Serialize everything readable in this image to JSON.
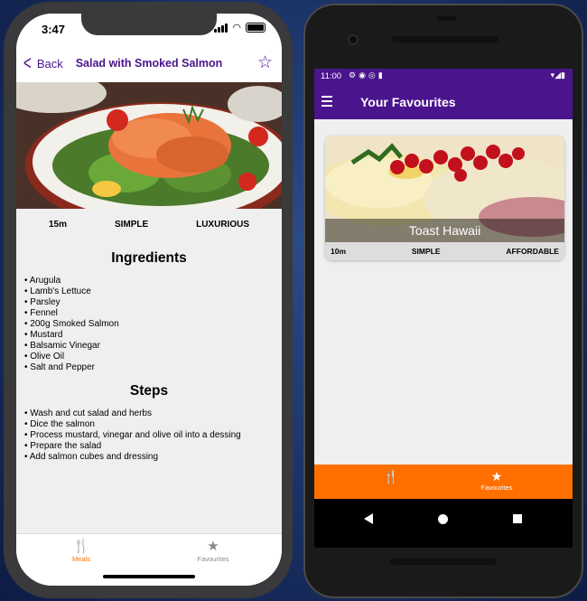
{
  "ios": {
    "status_time": "3:47",
    "nav": {
      "back_label": "Back",
      "title": "Salad with Smoked Salmon",
      "favorite_icon": "star-outline-icon"
    },
    "meal_info": {
      "duration": "15m",
      "complexity": "SIMPLE",
      "affordability": "LUXURIOUS"
    },
    "ingredients_title": "Ingredients",
    "ingredients": [
      "Arugula",
      "Lamb's Lettuce",
      "Parsley",
      "Fennel",
      "200g Smoked Salmon",
      "Mustard",
      "Balsamic Vinegar",
      "Olive Oil",
      "Salt and Pepper"
    ],
    "steps_title": "Steps",
    "steps": [
      "Wash and cut salad and herbs",
      "Dice the salmon",
      "Process mustard, vinegar and olive oil into a dessing",
      "Prepare the salad",
      "Add salmon cubes and dressing"
    ],
    "tabs": [
      {
        "label": "Meals",
        "icon": "cutlery-icon",
        "color": "#ff6f00"
      },
      {
        "label": "Favourites",
        "icon": "star-icon",
        "color": "#888888"
      }
    ]
  },
  "android": {
    "status_time": "11:00",
    "appbar_title": "Your Favourites",
    "favourites": [
      {
        "title": "Toast Hawaii",
        "duration": "10m",
        "complexity": "SIMPLE",
        "affordability": "AFFORDABLE"
      }
    ],
    "tabs": [
      {
        "label": "",
        "icon": "cutlery-icon"
      },
      {
        "label": "Favourites",
        "icon": "star-icon"
      }
    ]
  },
  "colors": {
    "primary": "#4a148c",
    "accent": "#ff6f00",
    "background": "#efefef"
  }
}
